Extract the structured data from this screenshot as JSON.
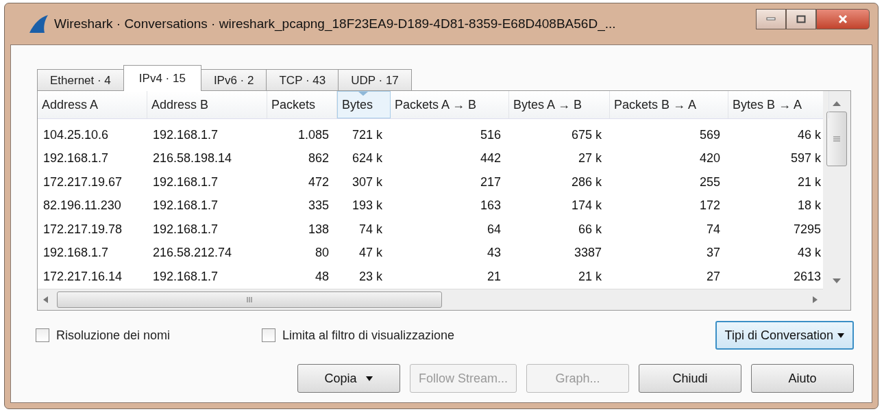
{
  "window": {
    "title": "Wireshark · Conversations · wireshark_pcapng_18F23EA9-D189-4D81-8359-E68D408BA56D_..."
  },
  "tabs": [
    {
      "label": "Ethernet · 4",
      "selected": false
    },
    {
      "label": "IPv4 · 15",
      "selected": true
    },
    {
      "label": "IPv6 · 2",
      "selected": false
    },
    {
      "label": "TCP · 43",
      "selected": false
    },
    {
      "label": "UDP · 17",
      "selected": false
    }
  ],
  "table": {
    "columns": [
      {
        "label": "Address A",
        "sorted": false
      },
      {
        "label": "Address B",
        "sorted": false
      },
      {
        "label": "Packets",
        "sorted": false
      },
      {
        "label": "Bytes",
        "sorted": true
      },
      {
        "label": "Packets A → B",
        "sorted": false
      },
      {
        "label": "Bytes A → B",
        "sorted": false
      },
      {
        "label": "Packets B → A",
        "sorted": false
      },
      {
        "label": "Bytes B → A",
        "sorted": false
      }
    ],
    "rows": [
      [
        "104.25.10.6",
        "192.168.1.7",
        "1.085",
        "721 k",
        "516",
        "675 k",
        "569",
        "46 k"
      ],
      [
        "192.168.1.7",
        "216.58.198.14",
        "862",
        "624 k",
        "442",
        "27 k",
        "420",
        "597 k"
      ],
      [
        "172.217.19.67",
        "192.168.1.7",
        "472",
        "307 k",
        "217",
        "286 k",
        "255",
        "21 k"
      ],
      [
        "82.196.11.230",
        "192.168.1.7",
        "335",
        "193 k",
        "163",
        "174 k",
        "172",
        "18 k"
      ],
      [
        "172.217.19.78",
        "192.168.1.7",
        "138",
        "74 k",
        "64",
        "66 k",
        "74",
        "7295"
      ],
      [
        "192.168.1.7",
        "216.58.212.74",
        "80",
        "47 k",
        "43",
        "3387",
        "37",
        "43 k"
      ],
      [
        "172.217.16.14",
        "192.168.1.7",
        "48",
        "23 k",
        "21",
        "21 k",
        "27",
        "2613"
      ]
    ]
  },
  "options": [
    {
      "label": "Risoluzione dei nomi",
      "checked": false
    },
    {
      "label": "Limita al filtro di visualizzazione",
      "checked": false
    }
  ],
  "types_button": {
    "label": "Tipi di Conversation",
    "focused": true
  },
  "buttons": [
    {
      "label": "Copia",
      "dropdown": true,
      "disabled": false
    },
    {
      "label": "Follow Stream...",
      "dropdown": false,
      "disabled": true
    },
    {
      "label": "Graph...",
      "dropdown": false,
      "disabled": true
    },
    {
      "label": "Chiudi",
      "dropdown": false,
      "disabled": false
    },
    {
      "label": "Aiuto",
      "dropdown": false,
      "disabled": false
    }
  ]
}
